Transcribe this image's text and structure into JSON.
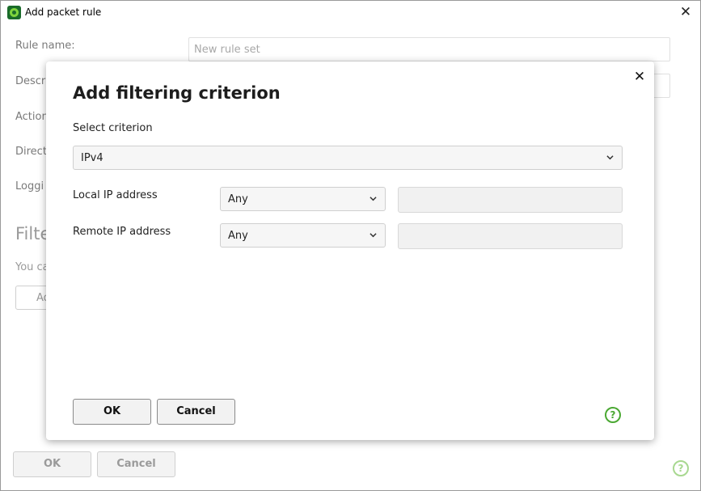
{
  "window": {
    "title": "Add packet rule",
    "close_glyph": "✕"
  },
  "background": {
    "rule_name_label": "Rule name:",
    "rule_name_placeholder": "New rule set",
    "description_label": "Descri",
    "action_label": "Action",
    "direction_label": "Directi",
    "logging_label": "Loggi",
    "section_title": "Filte",
    "section_desc": "You ca",
    "add_button_label": "Ad",
    "ok_label": "OK",
    "cancel_label": "Cancel",
    "help_glyph": "?"
  },
  "dialog": {
    "title": "Add filtering criterion",
    "close_glyph": "✕",
    "select_criterion_label": "Select criterion",
    "criterion_value": "IPv4",
    "local_ip_label": "Local IP address",
    "local_ip_value": "Any",
    "remote_ip_label": "Remote IP address",
    "remote_ip_value": "Any",
    "ok_label": "OK",
    "cancel_label": "Cancel",
    "help_glyph": "?"
  },
  "colors": {
    "accent": "#4aa832",
    "brand_dark": "#1a6b2a"
  },
  "icons": [
    "app-logo-icon",
    "close-icon",
    "chevron-down-icon",
    "help-icon"
  ]
}
